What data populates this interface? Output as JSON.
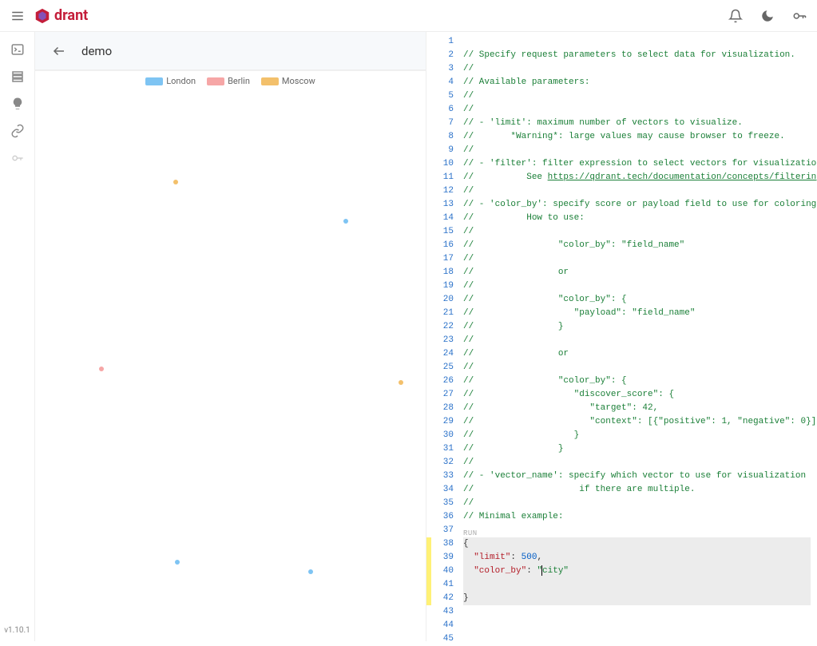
{
  "brand": {
    "name": "drant"
  },
  "header": {
    "title": "demo"
  },
  "version": "v1.10.1",
  "legend": [
    {
      "label": "London",
      "color": "#7ec4f3"
    },
    {
      "label": "Berlin",
      "color": "#f6a6a6"
    },
    {
      "label": "Moscow",
      "color": "#f3c06b"
    }
  ],
  "points": [
    {
      "x_pct": 36.0,
      "y_pct": 16.5,
      "color": "#f3c06b"
    },
    {
      "x_pct": 79.6,
      "y_pct": 23.6,
      "color": "#7ec4f3"
    },
    {
      "x_pct": 17.0,
      "y_pct": 50.5,
      "color": "#f6a6a6"
    },
    {
      "x_pct": 93.6,
      "y_pct": 53.0,
      "color": "#f3c06b"
    },
    {
      "x_pct": 36.5,
      "y_pct": 85.6,
      "color": "#7ec4f3"
    },
    {
      "x_pct": 70.6,
      "y_pct": 87.4,
      "color": "#7ec4f3"
    }
  ],
  "editor": {
    "run_label": "RUN",
    "link_text": "https://qdrant.tech/documentation/concepts/filtering/",
    "lines": [
      {
        "n": 1,
        "t": "",
        "cls": ""
      },
      {
        "n": 2,
        "t": "// Specify request parameters to select data for visualization.",
        "cls": "c-comment"
      },
      {
        "n": 3,
        "t": "//",
        "cls": "c-comment"
      },
      {
        "n": 4,
        "t": "// Available parameters:",
        "cls": "c-comment"
      },
      {
        "n": 5,
        "t": "//",
        "cls": "c-comment"
      },
      {
        "n": 6,
        "t": "//",
        "cls": "c-comment"
      },
      {
        "n": 7,
        "t": "// - 'limit': maximum number of vectors to visualize.",
        "cls": "c-comment"
      },
      {
        "n": 8,
        "t": "//       *Warning*: large values may cause browser to freeze.",
        "cls": "c-comment"
      },
      {
        "n": 9,
        "t": "//",
        "cls": "c-comment"
      },
      {
        "n": 10,
        "t": "// - 'filter': filter expression to select vectors for visualization.",
        "cls": "c-comment"
      },
      {
        "n": 11,
        "t": "//          See ",
        "cls": "c-comment",
        "link": true
      },
      {
        "n": 12,
        "t": "//",
        "cls": "c-comment"
      },
      {
        "n": 13,
        "t": "// - 'color_by': specify score or payload field to use for coloring points.",
        "cls": "c-comment"
      },
      {
        "n": 14,
        "t": "//          How to use:",
        "cls": "c-comment"
      },
      {
        "n": 15,
        "t": "//",
        "cls": "c-comment"
      },
      {
        "n": 16,
        "t": "//                \"color_by\": \"field_name\"",
        "cls": "c-comment"
      },
      {
        "n": 17,
        "t": "//",
        "cls": "c-comment"
      },
      {
        "n": 18,
        "t": "//                or",
        "cls": "c-comment"
      },
      {
        "n": 19,
        "t": "//",
        "cls": "c-comment"
      },
      {
        "n": 20,
        "t": "//                \"color_by\": {",
        "cls": "c-comment"
      },
      {
        "n": 21,
        "t": "//                   \"payload\": \"field_name\"",
        "cls": "c-comment"
      },
      {
        "n": 22,
        "t": "//                }",
        "cls": "c-comment"
      },
      {
        "n": 23,
        "t": "//",
        "cls": "c-comment"
      },
      {
        "n": 24,
        "t": "//                or",
        "cls": "c-comment"
      },
      {
        "n": 25,
        "t": "//",
        "cls": "c-comment"
      },
      {
        "n": 26,
        "t": "//                \"color_by\": {",
        "cls": "c-comment"
      },
      {
        "n": 27,
        "t": "//                   \"discover_score\": {",
        "cls": "c-comment"
      },
      {
        "n": 28,
        "t": "//                      \"target\": 42,",
        "cls": "c-comment"
      },
      {
        "n": 29,
        "t": "//                      \"context\": [{\"positive\": 1, \"negative\": 0}]",
        "cls": "c-comment"
      },
      {
        "n": 30,
        "t": "//                   }",
        "cls": "c-comment"
      },
      {
        "n": 31,
        "t": "//                }",
        "cls": "c-comment"
      },
      {
        "n": 32,
        "t": "//",
        "cls": "c-comment"
      },
      {
        "n": 33,
        "t": "// - 'vector_name': specify which vector to use for visualization",
        "cls": "c-comment"
      },
      {
        "n": 34,
        "t": "//                    if there are multiple.",
        "cls": "c-comment"
      },
      {
        "n": 35,
        "t": "//",
        "cls": "c-comment"
      },
      {
        "n": 36,
        "t": "// Minimal example:",
        "cls": "c-comment"
      },
      {
        "n": 37,
        "t": "",
        "cls": ""
      },
      {
        "n": 38,
        "t": "{",
        "cls": "c-punc",
        "hl": true,
        "pre_run": true
      },
      {
        "n": 39,
        "t": "  \"limit\": 500,",
        "cls": "json",
        "hl": true,
        "json": {
          "key": "\"limit\"",
          "colon": ": ",
          "val": "500",
          "trail": ","
        }
      },
      {
        "n": 40,
        "t": "  \"color_by\": \"city\"",
        "cls": "json",
        "hl": true,
        "cursor": true,
        "json": {
          "key": "\"color_by\"",
          "colon": ": ",
          "valq1": "\"",
          "valtxt": "city",
          "valq2": "\""
        }
      },
      {
        "n": 41,
        "t": "",
        "cls": "",
        "hl": true
      },
      {
        "n": 42,
        "t": "}",
        "cls": "c-punc",
        "hl": true
      },
      {
        "n": 43,
        "t": "",
        "cls": ""
      },
      {
        "n": 44,
        "t": "",
        "cls": ""
      },
      {
        "n": 45,
        "t": "",
        "cls": ""
      }
    ],
    "mod_range": {
      "start": 38,
      "end": 42
    }
  }
}
